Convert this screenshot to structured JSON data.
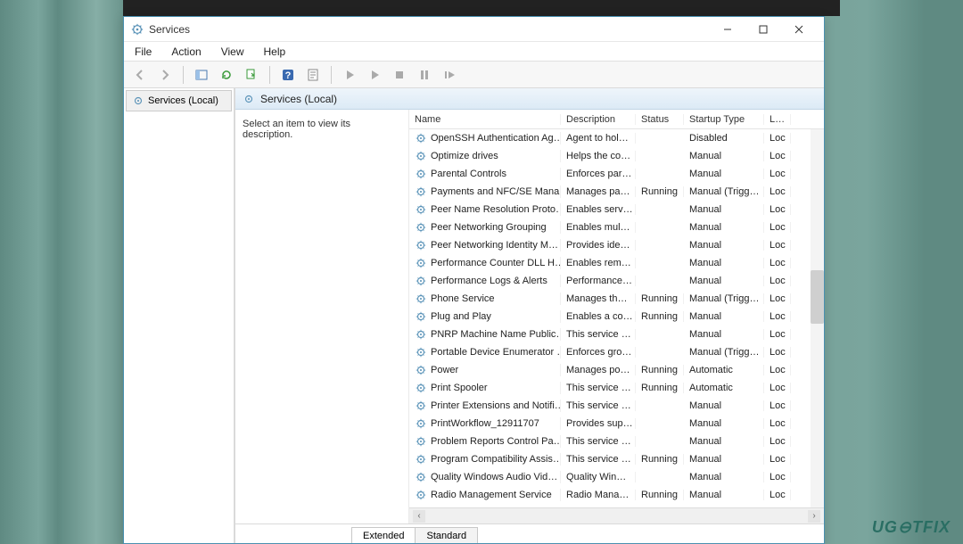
{
  "app": {
    "title": "Services"
  },
  "menus": {
    "file": "File",
    "action": "Action",
    "view": "View",
    "help": "Help"
  },
  "nav": {
    "label": "Services (Local)"
  },
  "pane": {
    "heading": "Services (Local)",
    "hint": "Select an item to view its description."
  },
  "columns": {
    "name": "Name",
    "description": "Description",
    "status": "Status",
    "startup": "Startup Type",
    "logon": "Log"
  },
  "tabs": {
    "extended": "Extended",
    "standard": "Standard"
  },
  "watermark": "UG⊖TFIX",
  "services": [
    {
      "name": "OpenSSH Authentication Ag…",
      "desc": "Agent to hol…",
      "status": "",
      "startup": "Disabled",
      "log": "Loc"
    },
    {
      "name": "Optimize drives",
      "desc": "Helps the co…",
      "status": "",
      "startup": "Manual",
      "log": "Loc"
    },
    {
      "name": "Parental Controls",
      "desc": "Enforces par…",
      "status": "",
      "startup": "Manual",
      "log": "Loc"
    },
    {
      "name": "Payments and NFC/SE Mana…",
      "desc": "Manages pa…",
      "status": "Running",
      "startup": "Manual (Trigg…",
      "log": "Loc"
    },
    {
      "name": "Peer Name Resolution Proto…",
      "desc": "Enables serv…",
      "status": "",
      "startup": "Manual",
      "log": "Loc"
    },
    {
      "name": "Peer Networking Grouping",
      "desc": "Enables mul…",
      "status": "",
      "startup": "Manual",
      "log": "Loc"
    },
    {
      "name": "Peer Networking Identity M…",
      "desc": "Provides ide…",
      "status": "",
      "startup": "Manual",
      "log": "Loc"
    },
    {
      "name": "Performance Counter DLL H…",
      "desc": "Enables rem…",
      "status": "",
      "startup": "Manual",
      "log": "Loc"
    },
    {
      "name": "Performance Logs & Alerts",
      "desc": "Performance…",
      "status": "",
      "startup": "Manual",
      "log": "Loc"
    },
    {
      "name": "Phone Service",
      "desc": "Manages th…",
      "status": "Running",
      "startup": "Manual (Trigg…",
      "log": "Loc"
    },
    {
      "name": "Plug and Play",
      "desc": "Enables a co…",
      "status": "Running",
      "startup": "Manual",
      "log": "Loc"
    },
    {
      "name": "PNRP Machine Name Public…",
      "desc": "This service …",
      "status": "",
      "startup": "Manual",
      "log": "Loc"
    },
    {
      "name": "Portable Device Enumerator …",
      "desc": "Enforces gro…",
      "status": "",
      "startup": "Manual (Trigg…",
      "log": "Loc"
    },
    {
      "name": "Power",
      "desc": "Manages po…",
      "status": "Running",
      "startup": "Automatic",
      "log": "Loc"
    },
    {
      "name": "Print Spooler",
      "desc": "This service …",
      "status": "Running",
      "startup": "Automatic",
      "log": "Loc"
    },
    {
      "name": "Printer Extensions and Notifi…",
      "desc": "This service …",
      "status": "",
      "startup": "Manual",
      "log": "Loc"
    },
    {
      "name": "PrintWorkflow_12911707",
      "desc": "Provides sup…",
      "status": "",
      "startup": "Manual",
      "log": "Loc"
    },
    {
      "name": "Problem Reports Control Pa…",
      "desc": "This service …",
      "status": "",
      "startup": "Manual",
      "log": "Loc"
    },
    {
      "name": "Program Compatibility Assis…",
      "desc": "This service …",
      "status": "Running",
      "startup": "Manual",
      "log": "Loc"
    },
    {
      "name": "Quality Windows Audio Vid…",
      "desc": "Quality Win…",
      "status": "",
      "startup": "Manual",
      "log": "Loc"
    },
    {
      "name": "Radio Management Service",
      "desc": "Radio Mana…",
      "status": "Running",
      "startup": "Manual",
      "log": "Loc"
    }
  ]
}
